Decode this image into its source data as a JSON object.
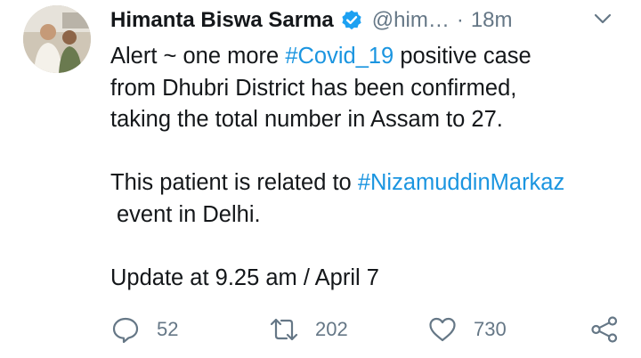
{
  "tweet": {
    "author_name": "Himanta Biswa Sarma",
    "handle": "@him…",
    "separator": "·",
    "time": "18m",
    "text_line1_pre": "Alert ~ one more ",
    "hashtag1": "#Covid_19",
    "text_line1_post": " positive case",
    "text_line2": "from Dhubri District has been confirmed,",
    "text_line3": "taking the total number in Assam to 27.",
    "text_line4_pre": "This patient is related to ",
    "hashtag2": "#NizamuddinMarkaz",
    "text_line5": "event in Delhi.",
    "update": "Update at 9.25 am / April 7"
  },
  "actions": {
    "replies": "52",
    "retweets": "202",
    "likes": "730"
  },
  "colors": {
    "accent": "#1b95e0",
    "muted": "#657786",
    "text": "#14171a"
  },
  "icons": [
    "verified-badge-icon",
    "chevron-down-icon",
    "reply-icon",
    "retweet-icon",
    "like-icon",
    "share-icon"
  ]
}
